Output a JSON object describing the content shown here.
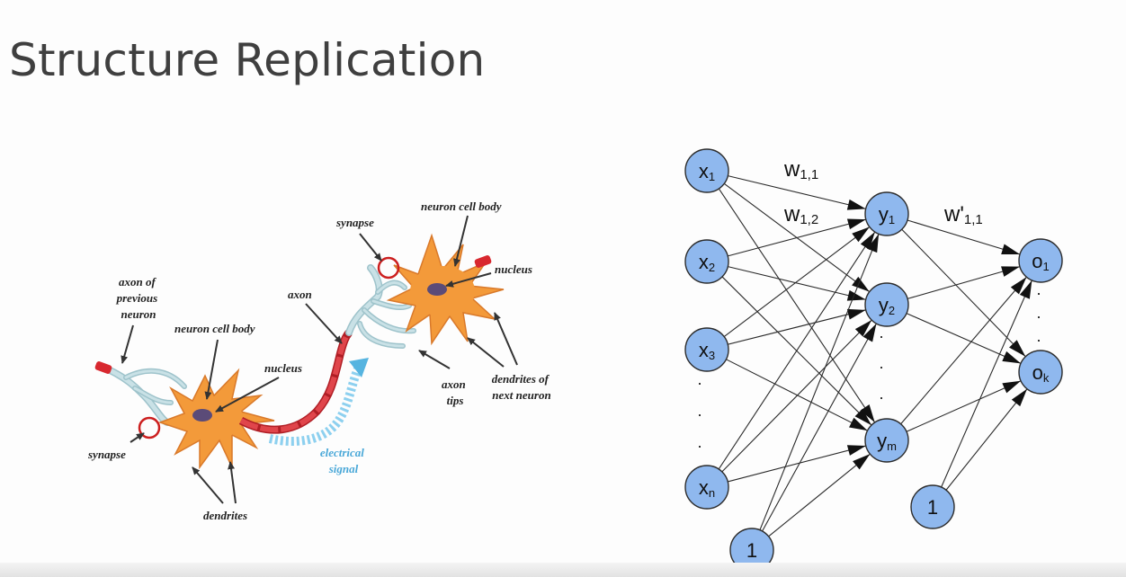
{
  "slide": {
    "title": "Structure Replication"
  },
  "neuron": {
    "axon_of_previous_neuron": [
      "axon of",
      "previous",
      "neuron"
    ],
    "synapse_left": "synapse",
    "neuron_cell_body_left": "neuron cell body",
    "nucleus_left": "nucleus",
    "dendrites": "dendrites",
    "electrical_signal": [
      "electrical",
      "signal"
    ],
    "axon": "axon",
    "synapse_top": "synapse",
    "neuron_cell_body_right": "neuron cell body",
    "nucleus_right": "nucleus",
    "axon_tips": [
      "axon",
      "tips"
    ],
    "dendrites_of_next_neuron": [
      "dendrites of",
      "next neuron"
    ]
  },
  "network": {
    "inputs": [
      {
        "base": "x",
        "sub": "1"
      },
      {
        "base": "x",
        "sub": "2"
      },
      {
        "base": "x",
        "sub": "3"
      },
      {
        "base": "x",
        "sub": "n"
      }
    ],
    "hidden": [
      {
        "base": "y",
        "sub": "1"
      },
      {
        "base": "y",
        "sub": "2"
      },
      {
        "base": "y",
        "sub": "m"
      }
    ],
    "outputs": [
      {
        "base": "o",
        "sub": "1"
      },
      {
        "base": "o",
        "sub": "k"
      }
    ],
    "bias_input": "1",
    "bias_hidden": "1",
    "weights": [
      {
        "base": "w",
        "sub": "1,1"
      },
      {
        "base": "w",
        "sub": "1,2"
      },
      {
        "base": "w'",
        "sub": "1,1"
      }
    ],
    "ellipsis": "."
  },
  "colors": {
    "node_fill": "#8fb8ee",
    "node_stroke": "#2c2c2c",
    "neuron_body": "#f39a3a",
    "axon": "#d8282f",
    "dendrite": "#b9d6dc",
    "signal": "#56b4e0",
    "synapse_circle": "#cc1f1f"
  }
}
